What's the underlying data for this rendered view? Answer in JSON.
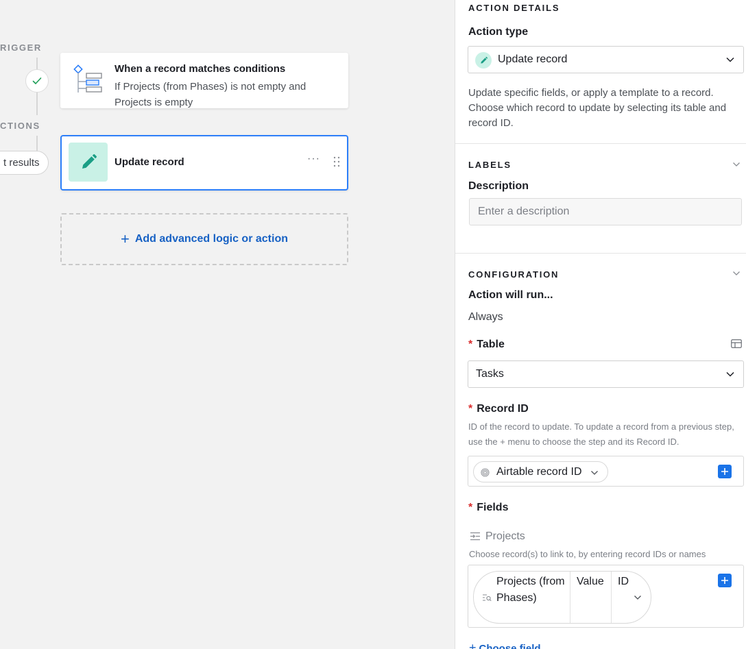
{
  "canvas": {
    "trigger_section_label": "RIGGER",
    "actions_section_label": "CTIONS",
    "results_pill_label": "t results",
    "trigger_card": {
      "title": "When a record matches conditions",
      "description": "If Projects (from Phases) is not empty and Projects is empty"
    },
    "action_card": {
      "title": "Update record",
      "more_label": "···"
    },
    "add_button_label": "Add advanced logic or action"
  },
  "panel": {
    "action_details": {
      "heading": "ACTION DETAILS",
      "action_type_label": "Action type",
      "action_type_value": "Update record",
      "description": "Update specific fields, or apply a template to a record. Choose which record to update by selecting its table and record ID."
    },
    "labels": {
      "heading": "LABELS",
      "description_label": "Description",
      "description_placeholder": "Enter a description"
    },
    "configuration": {
      "heading": "CONFIGURATION",
      "run_label": "Action will run...",
      "run_value": "Always",
      "table_label": "Table",
      "table_value": "Tasks",
      "record_id_label": "Record ID",
      "record_id_help": "ID of the record to update. To update a record from a previous step, use the + menu to choose the step and its Record ID.",
      "record_id_token": "Airtable record ID",
      "fields_label": "Fields",
      "field_name": "Projects",
      "field_help": "Choose record(s) to link to, by entering record IDs or names",
      "field_token_name": "Projects (from Phases)",
      "field_token_value": "Value",
      "field_token_id": "ID",
      "choose_field_label": "Choose field"
    }
  },
  "colors": {
    "accent_blue": "#2d7ff9",
    "link_blue": "#1761c4",
    "action_icon_bg": "#c9f1e6",
    "action_icon_fg": "#1a9e85",
    "required_red": "#d92d2d"
  }
}
